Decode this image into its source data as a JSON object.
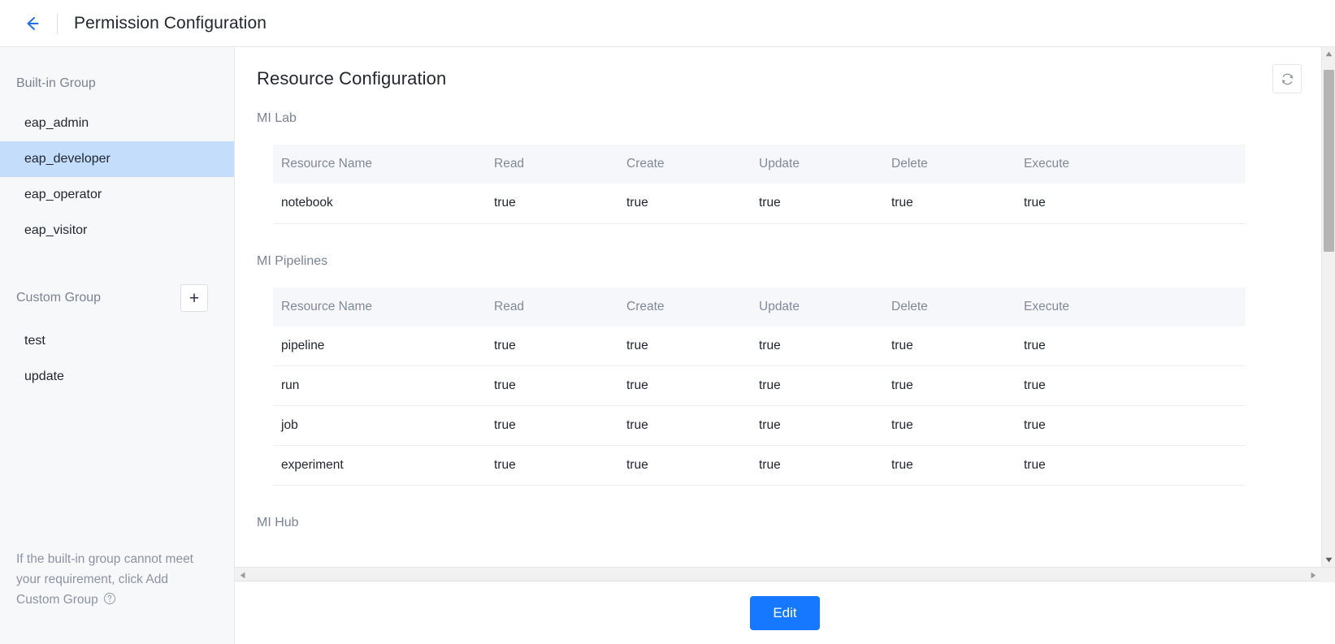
{
  "topbar": {
    "back_icon": "arrow-left-icon",
    "title": "Permission Configuration"
  },
  "sidebar": {
    "builtin_heading": "Built-in Group",
    "builtin_items": [
      {
        "label": "eap_admin",
        "active": false
      },
      {
        "label": "eap_developer",
        "active": true
      },
      {
        "label": "eap_operator",
        "active": false
      },
      {
        "label": "eap_visitor",
        "active": false
      }
    ],
    "custom_heading": "Custom Group",
    "add_label": "+",
    "custom_items": [
      {
        "label": "test",
        "active": false
      },
      {
        "label": "update",
        "active": false
      }
    ],
    "footnote": "If the built-in group cannot meet your requirement, click Add Custom Group",
    "footnote_icon": "help-circle-icon"
  },
  "main": {
    "title": "Resource Configuration",
    "refresh_icon": "refresh-icon",
    "columns": [
      "Resource Name",
      "Read",
      "Create",
      "Update",
      "Delete",
      "Execute"
    ],
    "groups": [
      {
        "label": "MI Lab",
        "rows": [
          {
            "name": "notebook",
            "read": "true",
            "create": "true",
            "update": "true",
            "delete": "true",
            "execute": "true"
          }
        ]
      },
      {
        "label": "MI Pipelines",
        "rows": [
          {
            "name": "pipeline",
            "read": "true",
            "create": "true",
            "update": "true",
            "delete": "true",
            "execute": "true"
          },
          {
            "name": "run",
            "read": "true",
            "create": "true",
            "update": "true",
            "delete": "true",
            "execute": "true"
          },
          {
            "name": "job",
            "read": "true",
            "create": "true",
            "update": "true",
            "delete": "true",
            "execute": "true"
          },
          {
            "name": "experiment",
            "read": "true",
            "create": "true",
            "update": "true",
            "delete": "true",
            "execute": "true"
          }
        ]
      },
      {
        "label": "MI Hub",
        "rows": []
      }
    ]
  },
  "footer": {
    "edit_label": "Edit"
  },
  "colors": {
    "accent": "#1677ff",
    "sidebar_active": "#c3ddfb",
    "back_arrow": "#1f6fe5",
    "muted_text": "#7a8293",
    "table_head_bg": "#f6f7fa"
  }
}
